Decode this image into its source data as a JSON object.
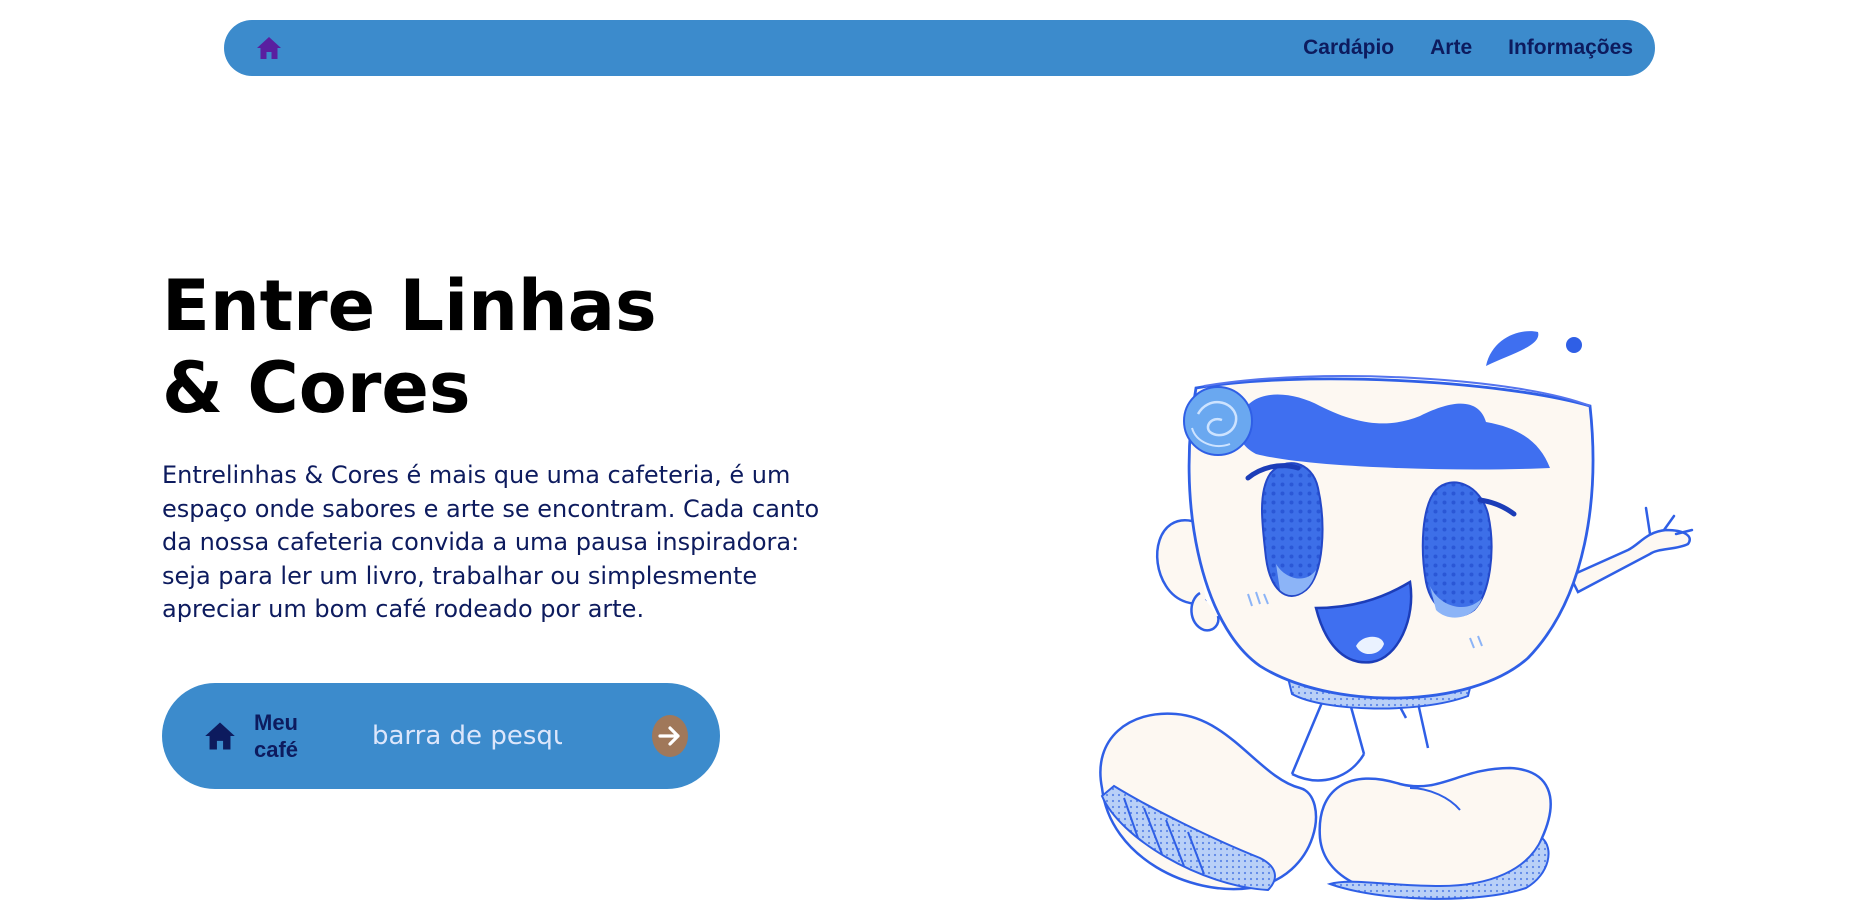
{
  "nav": {
    "home_icon": "home-icon",
    "links": [
      "Cardápio",
      "Arte",
      "Informações"
    ]
  },
  "hero": {
    "title_line1": "Entre Linhas",
    "title_line2": "& Cores",
    "description": "Entrelinhas & Cores é mais que uma cafeteria, é um espaço onde sabores e arte se encontram. Cada canto da nossa cafeteria convida a uma pausa inspiradora: seja para ler um livro, trabalhar ou simplesmente apreciar um bom café rodeado por arte."
  },
  "search": {
    "label_line1": "Meu",
    "label_line2": "café",
    "placeholder": "barra de pesquisa",
    "button_icon": "arrow-right-icon"
  },
  "colors": {
    "accent_blue": "#3c8bcc",
    "nav_text": "#0d1b5e",
    "home_icon_purple": "#5a1fa0",
    "arrow_button": "#a0785a",
    "mascot_blue": "#2f5fe6",
    "mascot_cream": "#fdf8f2"
  }
}
